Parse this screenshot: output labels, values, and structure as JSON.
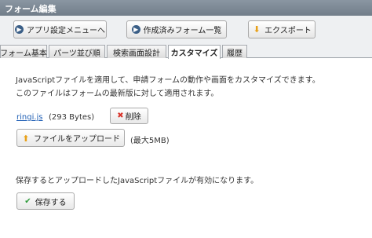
{
  "window": {
    "title": "フォーム編集"
  },
  "toolbar": {
    "back_label": "アプリ設定メニューへ",
    "forms_label": "作成済みフォーム一覧",
    "export_label": "エクスポート"
  },
  "tabs": [
    {
      "label": "フォーム基本"
    },
    {
      "label": "パーツ並び順"
    },
    {
      "label": "検索画面設計"
    },
    {
      "label": "カスタマイズ",
      "active": true
    },
    {
      "label": "履歴"
    }
  ],
  "customize": {
    "description_line1": "JavaScriptファイルを適用して、申請フォームの動作や画面をカスタマイズできます。",
    "description_line2": "このファイルはフォームの最新版に対して適用されます。",
    "file_name": "ringi.js",
    "file_size": "(293 Bytes)",
    "delete_label": "削除",
    "upload_label": "ファイルをアップロード",
    "max_size": "(最大5MB)",
    "save_note": "保存するとアップロードしたJavaScriptファイルが有効になります。",
    "save_label": "保存する"
  },
  "icons": {
    "back": "arrow-right-circle-icon",
    "forms": "arrow-right-circle-icon",
    "export": "download-icon",
    "delete": "close-icon",
    "upload": "upload-icon",
    "save": "check-icon"
  },
  "colors": {
    "titlebar": "#7f8b97",
    "link": "#1f5fb5",
    "icon_blue": "#3b5f87",
    "icon_orange": "#e8a11a",
    "delete_red": "#d9342b",
    "check_green": "#2e9b3a"
  }
}
